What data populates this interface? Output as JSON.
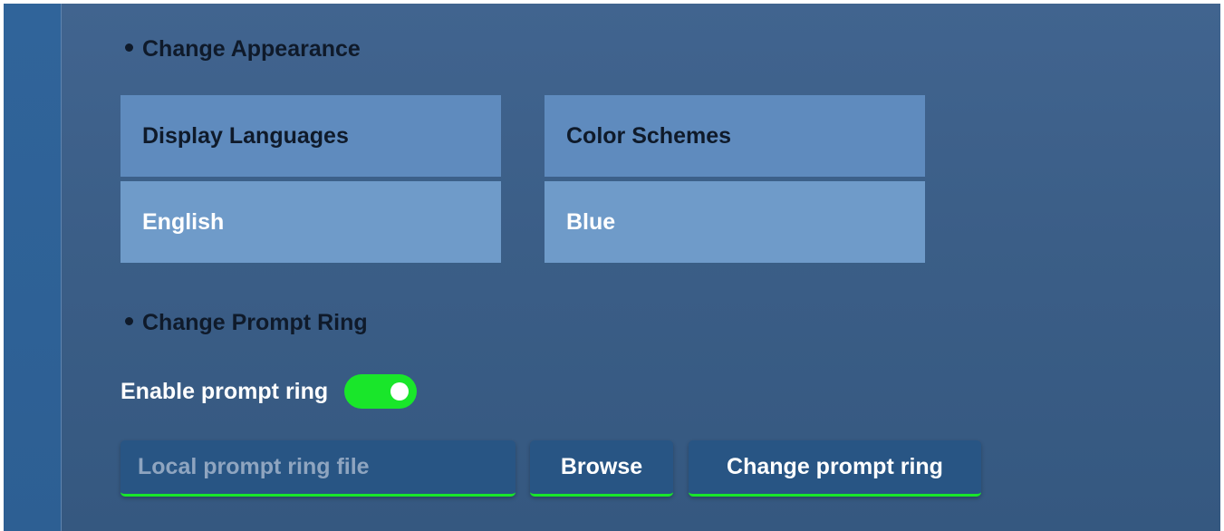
{
  "appearance": {
    "title": "Change Appearance",
    "languages": {
      "header": "Display Languages",
      "value": "English"
    },
    "schemes": {
      "header": "Color Schemes",
      "value": "Blue"
    }
  },
  "prompt_ring": {
    "title": "Change Prompt Ring",
    "enable_label": "Enable prompt ring",
    "enabled": true,
    "file_placeholder": "Local prompt ring file",
    "browse_label": "Browse",
    "change_label": "Change prompt ring"
  },
  "colors": {
    "toggle_on": "#19e62a",
    "background": "#3b5e87",
    "tile_header": "#5f8bbe",
    "tile_value": "#6f9bc9",
    "button": "#285584"
  }
}
